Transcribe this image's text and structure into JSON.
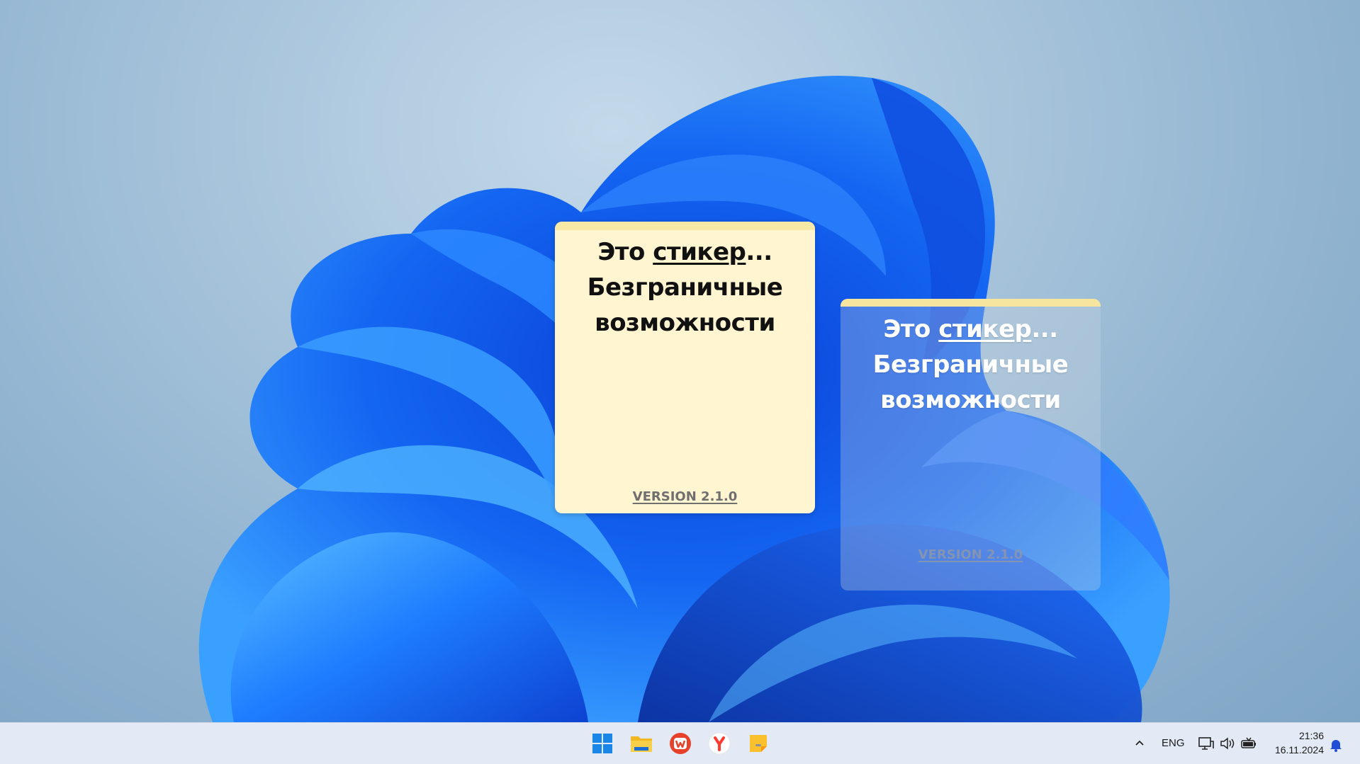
{
  "stickers": [
    {
      "line1_prefix": "Это ",
      "line1_link": "стикер",
      "line1_suffix": "...",
      "line2": "Безграничные",
      "line3": "возможности",
      "version": "VERSION 2.1.0"
    },
    {
      "line1_prefix": "Это ",
      "line1_link": "стикер",
      "line1_suffix": "...",
      "line2": "Безграничные",
      "line3": "возможности",
      "version": "VERSION 2.1.0"
    }
  ],
  "taskbar": {
    "apps": [
      {
        "name": "start",
        "icon": "windows-logo-icon"
      },
      {
        "name": "file-explorer",
        "icon": "folder-icon"
      },
      {
        "name": "wps-office",
        "icon": "wps-office-icon"
      },
      {
        "name": "yandex-browser",
        "icon": "yandex-browser-icon"
      },
      {
        "name": "sticky-notes",
        "icon": "sticky-note-icon",
        "running": true
      }
    ],
    "tray": {
      "chevron": "chevron-up-icon",
      "language": "ENG",
      "time": "21:36",
      "date": "16.11.2024",
      "icons": [
        "network-icon",
        "volume-icon",
        "battery-icon",
        "notification-bell-icon"
      ]
    }
  },
  "colors": {
    "accent_blue": "#1a6bff",
    "sticker_bg": "#fff5d1",
    "sticker_topbar": "#f8e9a6",
    "taskbar_bg": "#e3eaf5"
  }
}
